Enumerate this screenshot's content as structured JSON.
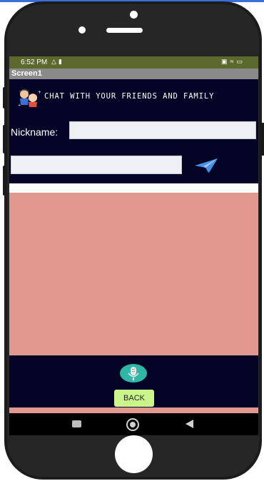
{
  "status_bar": {
    "time": "6:52 PM",
    "left_icons": [
      "notification-icon",
      "video-icon"
    ],
    "right_icons": [
      "cast-icon",
      "wifi-icon",
      "battery-icon"
    ]
  },
  "app": {
    "screen_title": "Screen1",
    "header_title": "CHAT WITH YOUR FRIENDS AND FAMILY"
  },
  "form": {
    "nickname_label": "Nickname:",
    "nickname_value": "",
    "message_value": ""
  },
  "controls": {
    "back_label": "BACK",
    "send_icon": "paper-plane-icon",
    "mic_icon": "microphone-icon"
  },
  "colors": {
    "screen_bg": "#030426",
    "chat_area": "#e0988f",
    "back_button": "#c9f58a",
    "status_bar": "#5a6a2c",
    "title_bar": "#8a8a8a",
    "mic_button": "#2fb6a7"
  }
}
